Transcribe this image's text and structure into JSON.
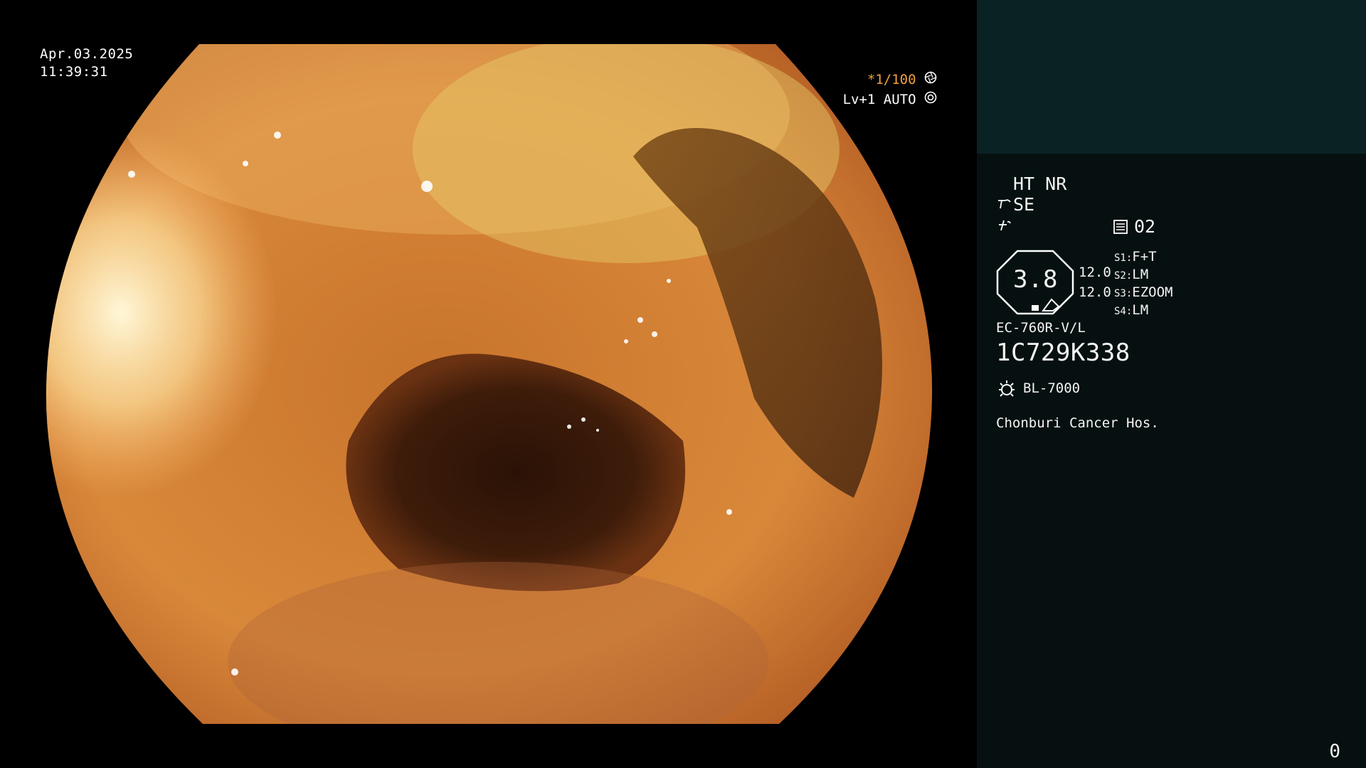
{
  "image": {
    "date": "Apr.03.2025",
    "time": "11:39:31",
    "shutter": "*1/100",
    "shutter_icon": "aperture-icon",
    "iris": "Lv+1 AUTO",
    "iris_icon": "iris-icon"
  },
  "panel": {
    "mode_top": "HT NR",
    "mode_se": "SE",
    "se_icon": "structure-enhance-icon",
    "edge_icon": "edge-enhance-icon",
    "counter_icon": "film-counter-icon",
    "counter": "02",
    "zoom": "3.8",
    "val_a": "12.0",
    "val_b": "12.0",
    "switches": [
      {
        "key": "S1",
        "value": "F+T"
      },
      {
        "key": "S2",
        "value": "LM"
      },
      {
        "key": "S3",
        "value": "EZOOM"
      },
      {
        "key": "S4",
        "value": "LM"
      }
    ],
    "scope_model": "EC-760R-V/L",
    "serial": "1C729K338",
    "light_icon": "light-source-icon",
    "light_source": "BL-7000",
    "hospital": "Chonburi Cancer Hos.",
    "corner": "0"
  },
  "colors": {
    "accent": "#f0a040",
    "panel_bg": "#061010",
    "panel_top": "#0b2224"
  }
}
